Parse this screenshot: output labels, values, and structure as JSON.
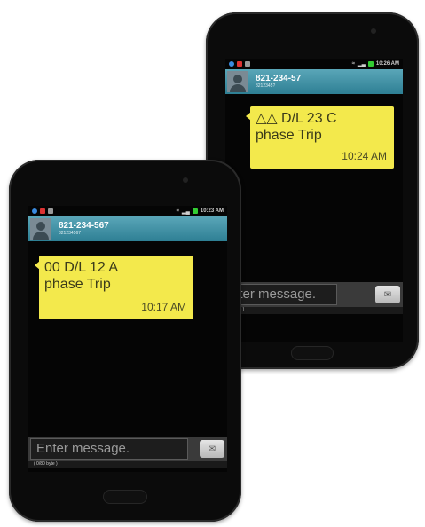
{
  "back_phone": {
    "contact_number": "821-234-57",
    "contact_sub": "8212345?",
    "message_line1": "△△ D/L 23 C",
    "message_line2": "phase Trip",
    "message_time": "10:24 AM",
    "status_time": "10:26 AM",
    "compose_placeholder": "nter message.",
    "compose_sub": "/ byte )"
  },
  "front_phone": {
    "contact_number": "821-234-567",
    "contact_sub": "821234567",
    "message_line1": "00 D/L 12 A",
    "message_line2": "phase Trip",
    "message_time": "10:17 AM",
    "status_time": "10:23 AM",
    "compose_placeholder": "Enter message.",
    "compose_sub": "( 0/80 byte )"
  },
  "colors": {
    "bubble": "#f3e94c",
    "contact_bar": "#2e7f94",
    "phone_body": "#0b0b0b"
  }
}
